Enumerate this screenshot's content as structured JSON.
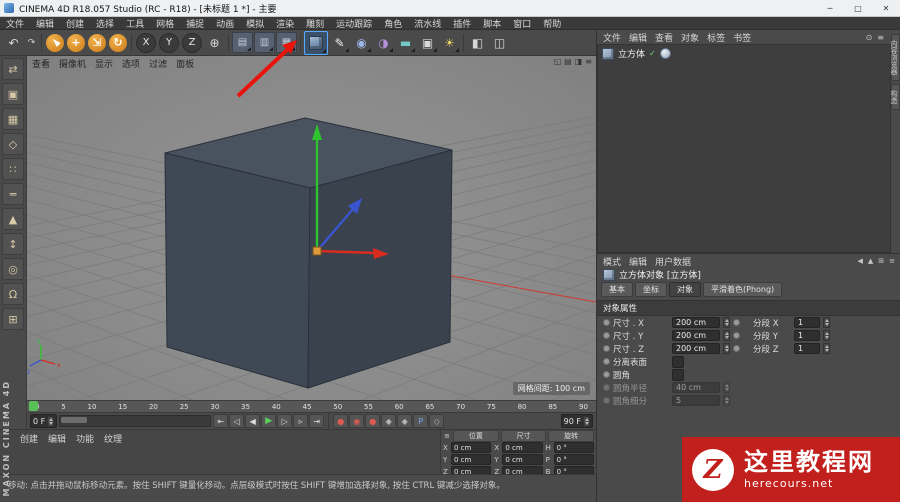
{
  "colors": {
    "cube_top": "#49525f",
    "cube_left": "#3f4855",
    "cube_right": "#3a424e",
    "cube_edge": "#2a303a",
    "axis_x": "#d92b1e",
    "axis_y": "#2fc42f",
    "axis_z": "#3a55cf",
    "annotation": "#e8140c",
    "highlight": "#57aaff",
    "watermark": "#c2201d"
  },
  "window": {
    "title": "CINEMA 4D R18.057 Studio (RC - R18) - [未标题 1 *] - 主要",
    "minimize": "─",
    "maximize": "□",
    "close": "✕"
  },
  "menubar": {
    "items": [
      "文件",
      "编辑",
      "创建",
      "选择",
      "工具",
      "网格",
      "捕捉",
      "动画",
      "模拟",
      "渲染",
      "雕刻",
      "运动跟踪",
      "角色",
      "流水线",
      "插件",
      "脚本",
      "窗口",
      "帮助"
    ]
  },
  "toolbar": {
    "undo": "↶",
    "redo": "↷",
    "live_selection": "►",
    "move": "+",
    "scale": "⇲",
    "rotate": "↻",
    "lock_x": "X",
    "lock_y": "Y",
    "lock_z": "Z",
    "coord_system": "⊕",
    "render_view": "▤",
    "render_region": "▥",
    "render_settings": "▦",
    "pen": "✎",
    "subdivision": "◉",
    "deformer": "◑",
    "floor": "▬",
    "camera": "▣",
    "light": "☀",
    "display": "◧",
    "layout_icon": "◫"
  },
  "left_toolbar": {
    "items": [
      {
        "name": "make-editable-icon",
        "glyph": "⇄"
      },
      {
        "name": "model-mode-icon",
        "glyph": "▣"
      },
      {
        "name": "texture-mode-icon",
        "glyph": "▦"
      },
      {
        "name": "workplane-mode-icon",
        "glyph": "◇"
      },
      {
        "name": "points-mode-icon",
        "glyph": "∷"
      },
      {
        "name": "edges-mode-icon",
        "glyph": "═"
      },
      {
        "name": "polygons-mode-icon",
        "glyph": "▲"
      },
      {
        "name": "enable-axis-icon",
        "glyph": "↕"
      },
      {
        "name": "solo-mode-icon",
        "glyph": "◎"
      },
      {
        "name": "snap-icon",
        "glyph": "Ω"
      },
      {
        "name": "workplane-lock-icon",
        "glyph": "⊞"
      }
    ]
  },
  "branding": {
    "vertical": "MAXON CINEMA 4D"
  },
  "viewport": {
    "menu": [
      "查看",
      "摄像机",
      "显示",
      "选项",
      "过滤",
      "面板"
    ],
    "corner_icons": [
      {
        "name": "pane-single-icon",
        "glyph": "◱"
      },
      {
        "name": "pane-rows-icon",
        "glyph": "▤"
      },
      {
        "name": "pane-split-icon",
        "glyph": "◨"
      },
      {
        "name": "pane-menu-icon",
        "glyph": "≡"
      }
    ],
    "grid_label": "网格间距: 100 cm",
    "axis_indicator": {
      "x": "x",
      "y": "y",
      "z": "z"
    }
  },
  "object_manager": {
    "menu": [
      "文件",
      "编辑",
      "查看",
      "对象",
      "标签",
      "书签"
    ],
    "corner_icons": [
      {
        "name": "om-filter-icon",
        "glyph": "⊙"
      },
      {
        "name": "om-menu-icon",
        "glyph": "≡"
      }
    ],
    "objects": [
      {
        "label": "立方体"
      }
    ],
    "right_tabs": [
      "内容浏览器",
      "构造"
    ]
  },
  "attribute_manager": {
    "menu": [
      "模式",
      "编辑",
      "用户数据"
    ],
    "corner_icons": [
      {
        "name": "am-back-icon",
        "glyph": "◀"
      },
      {
        "name": "am-up-icon",
        "glyph": "▲"
      },
      {
        "name": "am-grid-icon",
        "glyph": "⊞"
      },
      {
        "name": "am-menu-icon",
        "glyph": "≡"
      }
    ],
    "title": "立方体对象 [立方体]",
    "tabs": [
      "基本",
      "坐标",
      "对象",
      "平滑着色(Phong)"
    ],
    "active_tab": "对象",
    "section": "对象属性",
    "fields": {
      "size_x_label": "尺寸 . X",
      "size_x": "200 cm",
      "seg_x_label": "分段 X",
      "seg_x": "1",
      "size_y_label": "尺寸 . Y",
      "size_y": "200 cm",
      "seg_y_label": "分段 Y",
      "seg_y": "1",
      "size_z_label": "尺寸 . Z",
      "size_z": "200 cm",
      "seg_z_label": "分段 Z",
      "seg_z": "1",
      "separate_label": "分离表面",
      "fillet_label": "圆角",
      "fillet_radius_label": "圆角半径",
      "fillet_radius": "40 cm",
      "fillet_subdiv_label": "圆角细分",
      "fillet_subdiv": "5"
    }
  },
  "timeline": {
    "ticks": [
      "0",
      "5",
      "10",
      "15",
      "20",
      "25",
      "30",
      "35",
      "40",
      "45",
      "50",
      "55",
      "60",
      "65",
      "70",
      "75",
      "80",
      "85",
      "90"
    ],
    "current": "0 F",
    "end": "90 F",
    "transport": [
      {
        "name": "goto-start-button",
        "glyph": "⇤"
      },
      {
        "name": "prev-key-button",
        "glyph": "◁"
      },
      {
        "name": "prev-frame-button",
        "glyph": "◀"
      },
      {
        "name": "play-button",
        "glyph": "▶",
        "cls": "play"
      },
      {
        "name": "next-frame-button",
        "glyph": "▷"
      },
      {
        "name": "next-key-button",
        "glyph": "▹"
      },
      {
        "name": "goto-end-button",
        "glyph": "⇥"
      }
    ],
    "record": [
      {
        "name": "record-keyframe-button",
        "glyph": "●",
        "cls": "red"
      },
      {
        "name": "autokey-button",
        "glyph": "◉",
        "cls": "red"
      },
      {
        "name": "record-position-button",
        "glyph": "●",
        "cls": "red"
      },
      {
        "name": "record-scale-button",
        "glyph": "◆",
        "cls": "dim"
      },
      {
        "name": "record-rotation-button",
        "glyph": "◆",
        "cls": "dim"
      },
      {
        "name": "record-parameter-button",
        "glyph": "P",
        "cls": "blue"
      },
      {
        "name": "pla-button",
        "glyph": "◇",
        "cls": "dim"
      }
    ]
  },
  "material_manager": {
    "menu": [
      "创建",
      "编辑",
      "功能",
      "纹理"
    ]
  },
  "coordinates": {
    "headers": [
      "位置",
      "尺寸",
      "旋转"
    ],
    "pos": {
      "x_label": "X",
      "x": "0 cm",
      "y_label": "Y",
      "y": "0 cm",
      "z_label": "Z",
      "z": "0 cm"
    },
    "size": {
      "x_label": "X",
      "x": "0 cm",
      "y_label": "Y",
      "y": "0 cm",
      "z_label": "Z",
      "z": "0 cm"
    },
    "rot": {
      "h_label": "H",
      "h": "0 °",
      "p_label": "P",
      "p": "0 °",
      "b_label": "B",
      "b": "0 °"
    }
  },
  "statusbar": {
    "text": "移动: 点击并拖动鼠标移动元素。按住 SHIFT 键量化移动。点层级模式时按住 SHIFT 键增加选择对象, 按住 CTRL 键减少选择对象。"
  },
  "watermark": {
    "logo": "Z",
    "brand": "这里教程网",
    "domain": "herecours.net"
  },
  "ui": {
    "check": "✓"
  }
}
